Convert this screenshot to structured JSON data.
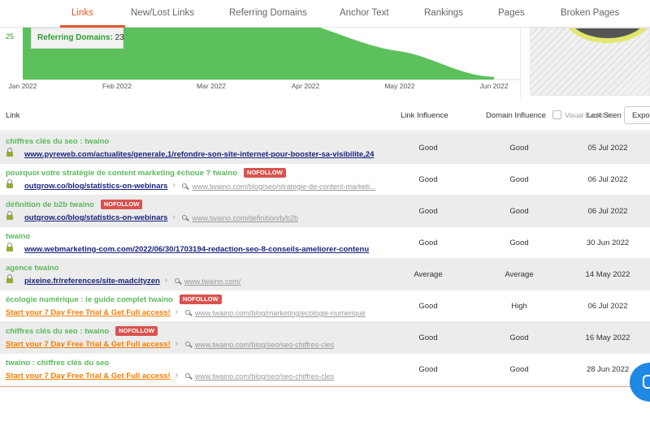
{
  "tabs": [
    {
      "label": "Links",
      "active": true
    },
    {
      "label": "New/Lost Links"
    },
    {
      "label": "Referring Domains"
    },
    {
      "label": "Anchor Text"
    },
    {
      "label": "Rankings"
    },
    {
      "label": "Pages"
    },
    {
      "label": "Broken Pages"
    }
  ],
  "chart_data": {
    "type": "area",
    "x": [
      "Jan 2022",
      "Feb 2022",
      "Mar 2022",
      "Apr 2022",
      "May 2022",
      "Jun 2022"
    ],
    "series": [
      {
        "name": "Referring Domains",
        "values": [
          27,
          27,
          27,
          23,
          13,
          4
        ]
      }
    ],
    "y_tick_visible": "25",
    "tooltip": {
      "label": "Referring Domains:",
      "value": "23"
    },
    "color": "#5cc15c"
  },
  "table": {
    "headers": {
      "link": "Link",
      "link_influence": "Link Influence",
      "domain_influence": "Domain Influence",
      "visual_label": "Visual Backlinks",
      "last_seen": "Last Seen",
      "export": "Export"
    },
    "rows": [
      {
        "title": "chiffres clés du seo : twaino",
        "nofollow": false,
        "url": "www.pyreweb.com/actualites/generale,1/refondre-son-site-internet-pour-booster-sa-visibilite,24",
        "promo": false,
        "dest": "",
        "link_influence": "Good",
        "domain_influence": "Good",
        "last_seen": "05 Jul 2022"
      },
      {
        "title": "pourquoi votre stratégie de content marketing échoue ? twaino",
        "nofollow": true,
        "url": "outgrow.co/blog/statistics-on-webinars",
        "promo": false,
        "dest": "www.twaino.com/blog/seo/strategie-de-content-marketi...",
        "link_influence": "Good",
        "domain_influence": "Good",
        "last_seen": "06 Jul 2022"
      },
      {
        "title": "définition de b2b twaino",
        "nofollow": true,
        "url": "outgrow.co/blog/statistics-on-webinars",
        "promo": false,
        "dest": "www.twaino.com/definition/b/b2b",
        "link_influence": "Good",
        "domain_influence": "Good",
        "last_seen": "06 Jul 2022"
      },
      {
        "title": "twaino",
        "nofollow": false,
        "url": "www.webmarketing-com.com/2022/06/30/1703194-redaction-seo-8-conseils-ameliorer-contenu",
        "promo": false,
        "dest": "",
        "link_influence": "Good",
        "domain_influence": "Good",
        "last_seen": "30 Jun 2022"
      },
      {
        "title": "agence twaino",
        "nofollow": false,
        "url": "pixeine.fr/references/site-madcityzen",
        "promo": false,
        "dest": "www.twaino.com/",
        "link_influence": "Average",
        "domain_influence": "Average",
        "last_seen": "14 May 2022"
      },
      {
        "title": "écologie numérique : le guide complet twaino",
        "nofollow": true,
        "url": "Start your 7 Day Free Trial & Get Full access!",
        "promo": true,
        "dest": "www.twaino.com/blog/marketing/ecologie-numerique",
        "link_influence": "Good",
        "domain_influence": "High",
        "last_seen": "06 Jul 2022"
      },
      {
        "title": "chiffres clés du seo : twaino",
        "nofollow": true,
        "url": "Start your 7 Day Free Trial & Get Full access!",
        "promo": true,
        "dest": "www.twaino.com/blog/seo/seo-chiffres-cles",
        "link_influence": "Good",
        "domain_influence": "Good",
        "last_seen": "16 May 2022"
      },
      {
        "title": "twaino : chiffres clés du seo",
        "nofollow": false,
        "url": "Start your 7 Day Free Trial & Get Full access!",
        "promo": true,
        "dest": "www.twaino.com/blog/seo/seo-chiffres-cles",
        "link_influence": "Good",
        "domain_influence": "Good",
        "last_seen": "28 Jun 2022"
      }
    ],
    "nofollow_label": "NOFOLLOW"
  },
  "colors": {
    "accent": "#e05a2b",
    "title_green": "#5cb85c",
    "badge_red": "#d9534f",
    "promo_orange": "#f57c00"
  }
}
